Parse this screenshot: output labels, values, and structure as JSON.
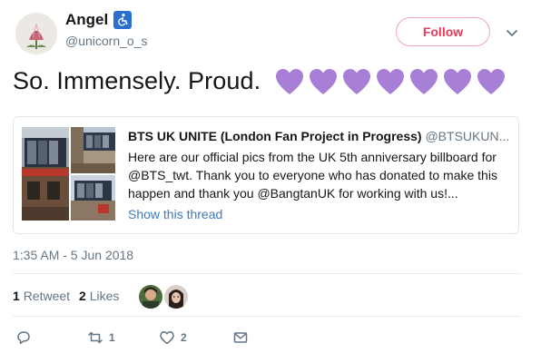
{
  "user": {
    "display_name": "Angel",
    "handle": "@unicorn_o_s",
    "badge_icon": "accessibility-icon",
    "follow_label": "Follow"
  },
  "tweet": {
    "text": "So. Immensely. Proud.",
    "emoji": [
      "purple-heart",
      "purple-heart",
      "purple-heart",
      "purple-heart",
      "purple-heart",
      "purple-heart",
      "purple-heart"
    ],
    "timestamp": "1:35 AM - 5 Jun 2018"
  },
  "quoted": {
    "author_name": "BTS UK UNITE (London Fan Project in Progress)",
    "author_handle": "@BTSUKUN...",
    "text": "Here are our official pics from the UK 5th anniversary billboard for @BTS_twt. Thank you to everyone who has donated to make this happen and thank you @BangtanUK for working with us!...",
    "thread_link": "Show this thread"
  },
  "stats": {
    "retweet_count": "1",
    "retweet_label": "Retweet",
    "like_count": "2",
    "like_label": "Likes"
  },
  "actions": {
    "retweet_count": "1",
    "like_count": "2"
  },
  "colors": {
    "heart_purple": "#a87fd6",
    "follow_pink": "#e7395a",
    "link_blue": "#3c7bbd",
    "muted": "#657786"
  }
}
